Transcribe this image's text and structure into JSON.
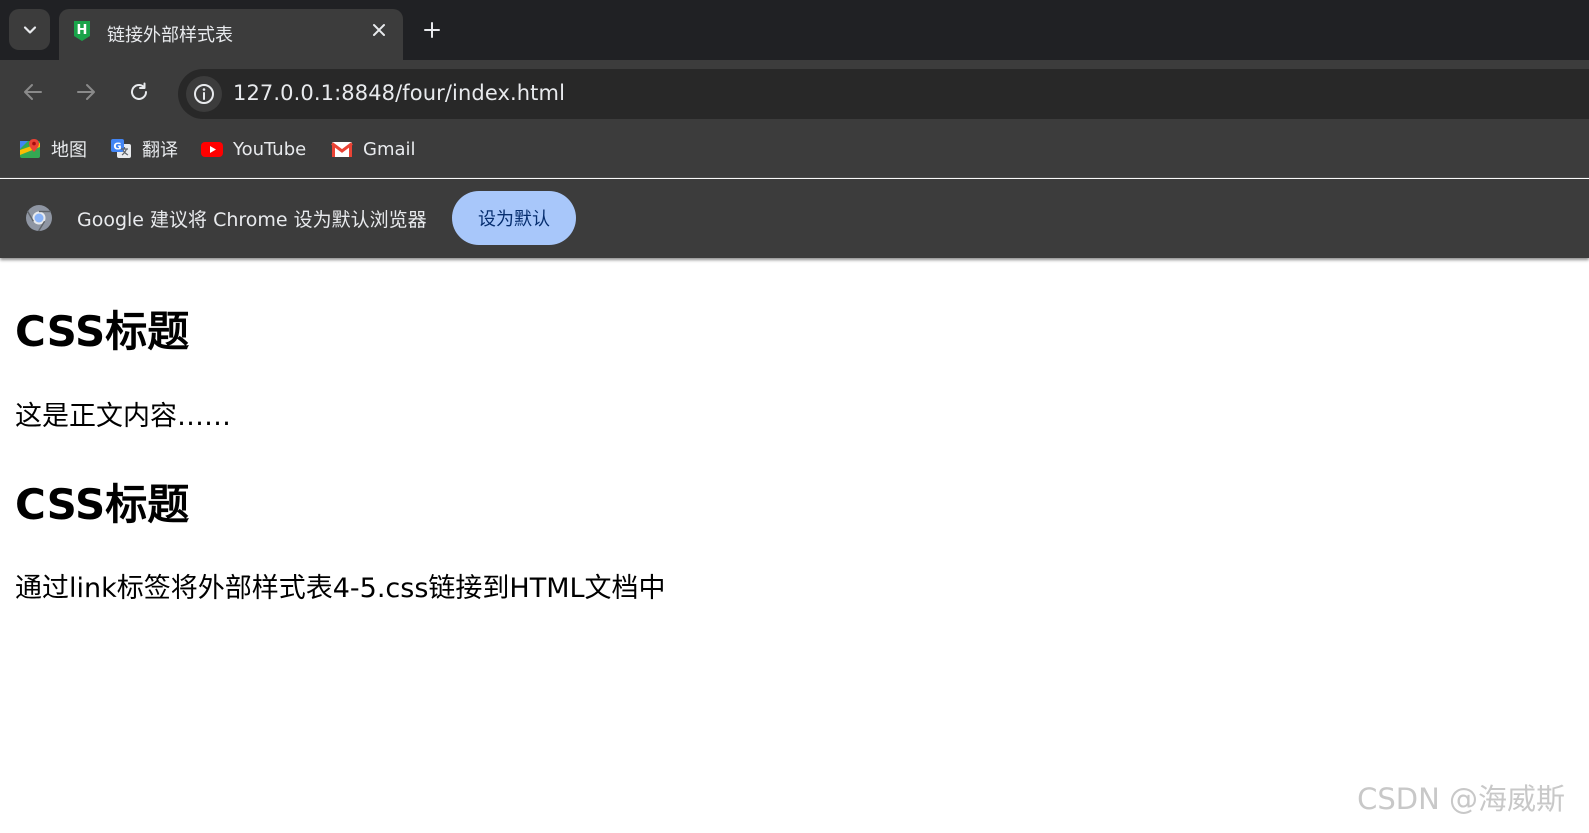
{
  "tabstrip": {
    "tab_title": "链接外部样式表",
    "favicon_letter": "H"
  },
  "toolbar": {
    "url": "127.0.0.1:8848/four/index.html"
  },
  "bookmarks": [
    {
      "label": "地图",
      "icon": "maps-icon"
    },
    {
      "label": "翻译",
      "icon": "translate-icon"
    },
    {
      "label": "YouTube",
      "icon": "youtube-icon"
    },
    {
      "label": "Gmail",
      "icon": "gmail-icon"
    }
  ],
  "infobar": {
    "message": "Google 建议将 Chrome 设为默认浏览器",
    "button_label": "设为默认"
  },
  "page": {
    "heading1": "CSS标题",
    "paragraph1": "这是正文内容……",
    "heading2": "CSS标题",
    "paragraph2": "通过link标签将外部样式表4-5.css链接到HTML文档中"
  },
  "watermark": "CSDN @海威斯",
  "colors": {
    "tabstrip_bg": "#202124",
    "toolbar_bg": "#3c3c3c",
    "button_bg": "#a8c7fa",
    "favicon_green": "#1aa34a"
  }
}
